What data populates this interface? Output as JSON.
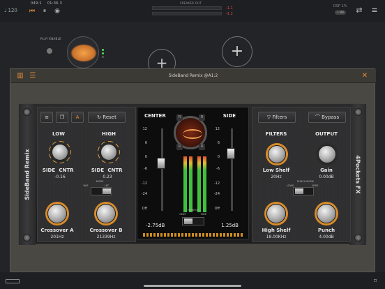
{
  "host": {
    "tempo": "♩ 120",
    "position_bars": "049:1",
    "position_time": "01:36.3",
    "meter_title": "SPEAKER OUT",
    "meter_left": "-1.1",
    "meter_right": "-1.2",
    "cpu_label": "DSP 1%",
    "cpu_pill": "1 MB",
    "play_enable": "PLAY ENABLE"
  },
  "window": {
    "title": "SideBand Remix @A1:2",
    "close_icon": "close-icon",
    "accent": "#e08a3a"
  },
  "plugin": {
    "brand_left": "SideBand Remix",
    "brand_right": "4Pockets FX",
    "reset_label": "Reset",
    "filters_label": "Filters",
    "bypass_label": "Bypass",
    "left": {
      "low_title": "LOW",
      "high_title": "HIGH",
      "low_side": "SIDE",
      "low_cntr": "CNTR",
      "low_value": "-0.16",
      "high_side": "SIDE",
      "high_cntr": "CNTR",
      "high_value": "0.23",
      "mode_title": "MODE",
      "mode_bas": "BAS",
      "mode_lkt": "LKT",
      "crossover_a_label": "Crossover A",
      "crossover_a_value": "201Hz",
      "crossover_b_label": "Crossover B",
      "crossover_b_value": "21339Hz"
    },
    "center": {
      "center_title": "CENTER",
      "side_title": "SIDE",
      "center_value": "-2.75dB",
      "side_value": "1.25dB",
      "monitor_title": "MONITOR",
      "monitor_cent": "CENT",
      "monitor_side": "SIDE",
      "r_label": "R",
      "scale_left": [
        "12",
        "6",
        "0",
        "-6",
        "-12",
        "-24",
        "Off"
      ],
      "scale_right": [
        "12",
        "6",
        "0",
        "-6",
        "-12",
        "-24",
        "Off"
      ]
    },
    "right": {
      "filters_title": "FILTERS",
      "output_title": "OUTPUT",
      "low_shelf_label": "Low Shelf",
      "low_shelf_value": "20Hz",
      "gain_label": "Gain",
      "gain_value": "0.00dB",
      "punch_mode_title": "PUNCH MODE",
      "punch_mode_lows": "LOWS",
      "punch_mode_mids": "MIDS",
      "high_shelf_label": "High Shelf",
      "high_shelf_value": "18.00KHz",
      "punch_label": "Punch",
      "punch_value": "4.00dB"
    }
  }
}
